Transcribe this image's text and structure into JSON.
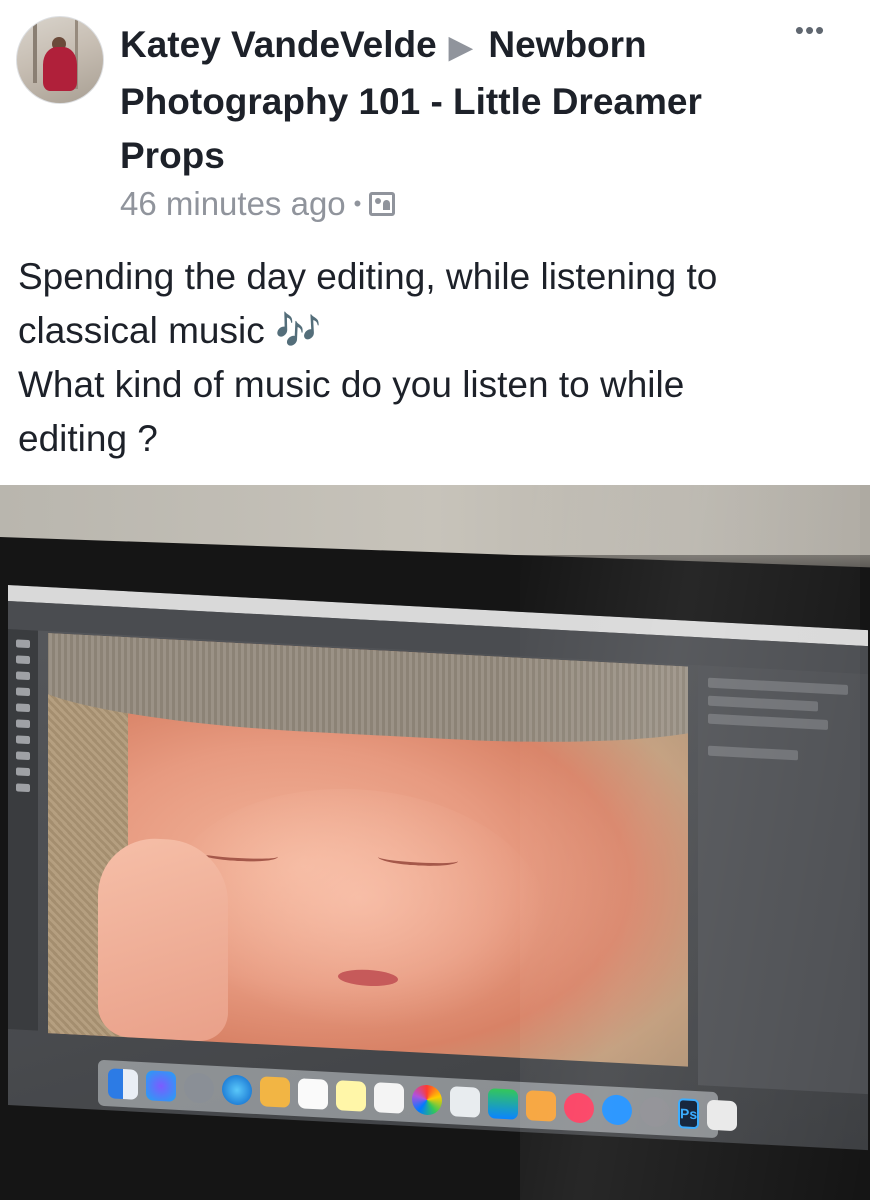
{
  "post": {
    "author": "Katey VandeVelde",
    "separator_icon": "right-triangle-icon",
    "group": "Newborn Photography 101 - Little Dreamer Props",
    "timestamp": "46 minutes ago",
    "dot": "•",
    "audience_icon": "photo-album-icon",
    "more_label": "•••",
    "text_lines": [
      "Spending the day editing, while listening to",
      "classical music 🎶",
      "What kind of music do you listen to while",
      "editing ?"
    ]
  },
  "photo": {
    "subject": "monitor-photo",
    "dock_badge": "Ps",
    "colors": {
      "ps_blue": "#31a8ff",
      "bezel": "#151515",
      "skin": "#e79a80"
    }
  }
}
